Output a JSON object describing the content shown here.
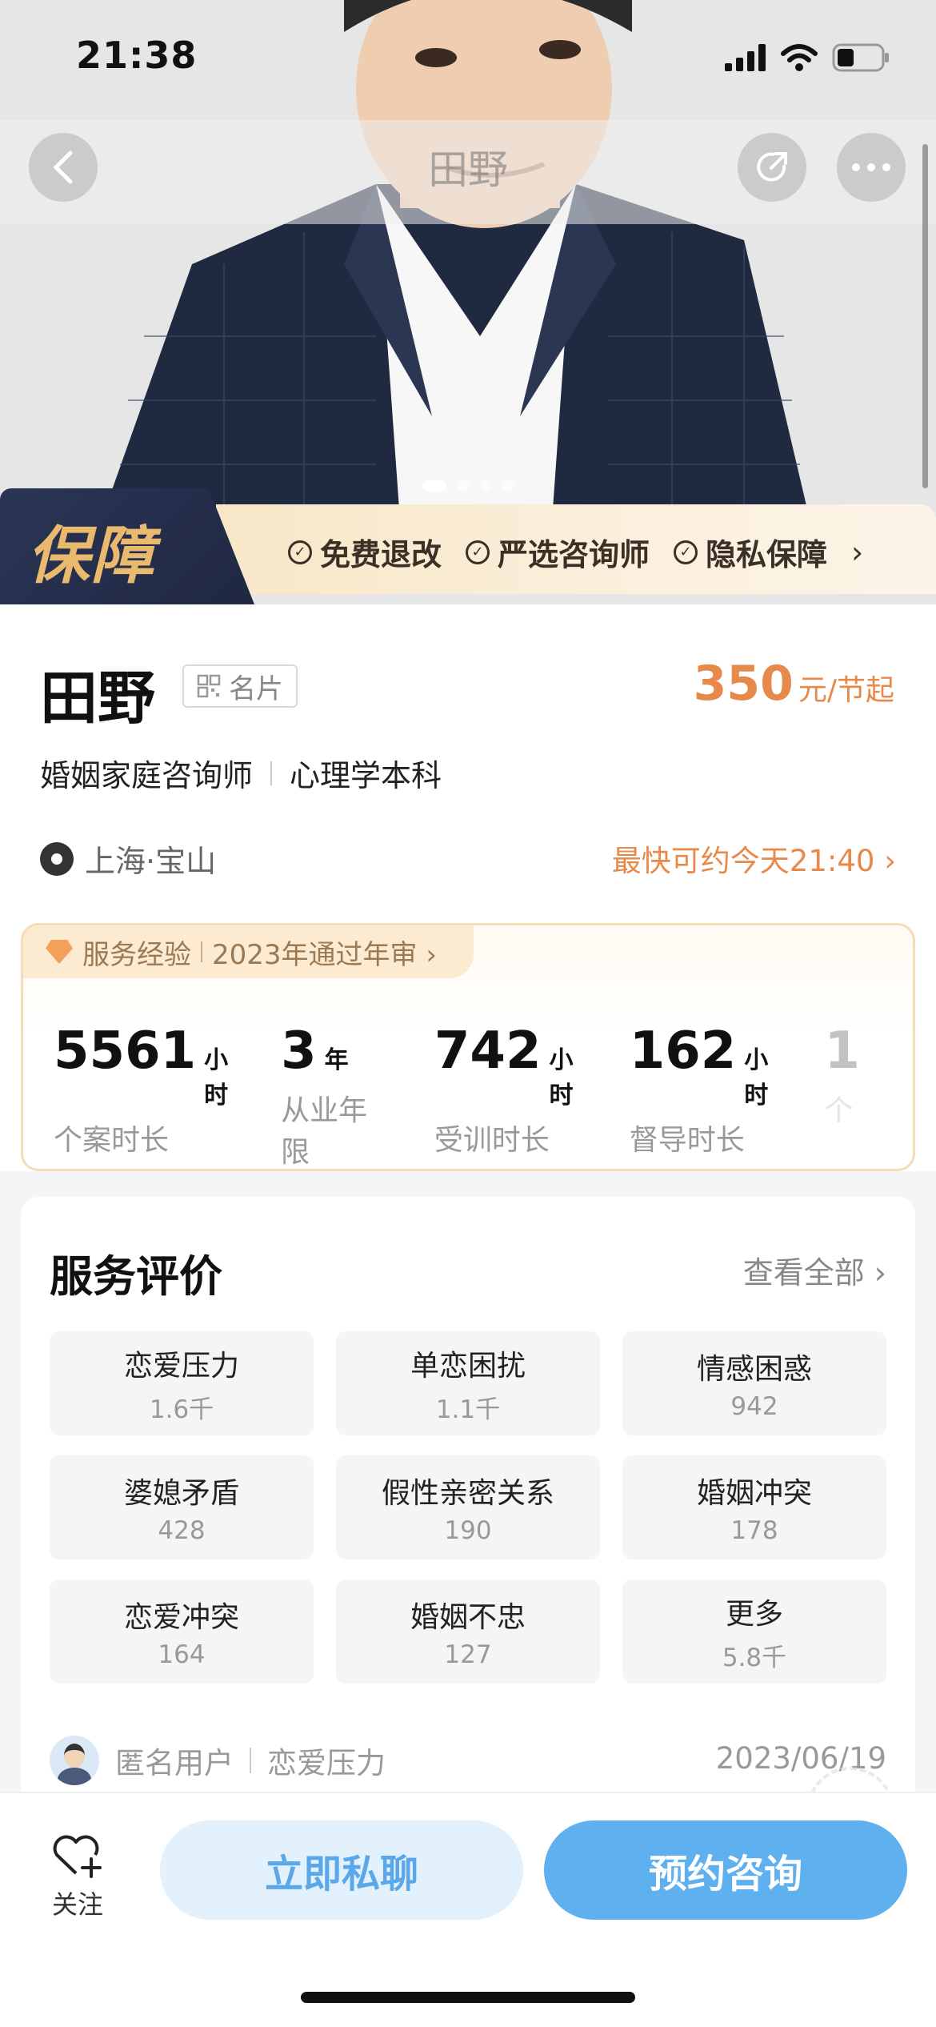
{
  "status": {
    "time": "21:38"
  },
  "nav": {
    "title": "田野"
  },
  "hero": {
    "photo_count": 4,
    "active_index": 0
  },
  "guarantee": {
    "title": "保障",
    "items": [
      "免费退改",
      "严选咨询师",
      "隐私保障"
    ],
    "arrow": "›"
  },
  "profile": {
    "name": "田野",
    "card_label": "名片",
    "price_value": "350",
    "price_unit": "元/节起",
    "roles": [
      "婚姻家庭咨询师",
      "心理学本科"
    ],
    "location": "上海·宝山",
    "earliest": "最快可约今天21:40 ›"
  },
  "experience": {
    "tag_label": "服务经验",
    "tag_note": "2023年通过年审 ›",
    "stats": [
      {
        "value": "5561",
        "unit": "小时",
        "label": "个案时长"
      },
      {
        "value": "3",
        "unit": "年",
        "label": "从业年限"
      },
      {
        "value": "742",
        "unit": "小时",
        "label": "受训时长"
      },
      {
        "value": "162",
        "unit": "小时",
        "label": "督导时长"
      },
      {
        "value": "1",
        "unit": "",
        "label": "个"
      }
    ]
  },
  "reviews": {
    "title": "服务评价",
    "view_all": "查看全部 ›",
    "tags": [
      {
        "name": "恋爱压力",
        "count": "1.6千"
      },
      {
        "name": "单恋困扰",
        "count": "1.1千"
      },
      {
        "name": "情感困惑",
        "count": "942"
      },
      {
        "name": "婆媳矛盾",
        "count": "428"
      },
      {
        "name": "假性亲密关系",
        "count": "190"
      },
      {
        "name": "婚姻冲突",
        "count": "178"
      },
      {
        "name": "恋爱冲突",
        "count": "164"
      },
      {
        "name": "婚姻不忠",
        "count": "127"
      },
      {
        "name": "更多",
        "count": "5.8千"
      }
    ],
    "first": {
      "user": "匿名用户",
      "topic": "恋爱压力",
      "date": "2023/06/19"
    }
  },
  "bottom": {
    "follow_label": "关注",
    "chat_label": "立即私聊",
    "book_label": "预约咨询"
  },
  "colors": {
    "accent": "#e7894a",
    "primary_blue": "#5fb0ef",
    "banner_navy": "#2b3556",
    "banner_gold": "#e9b96e"
  }
}
